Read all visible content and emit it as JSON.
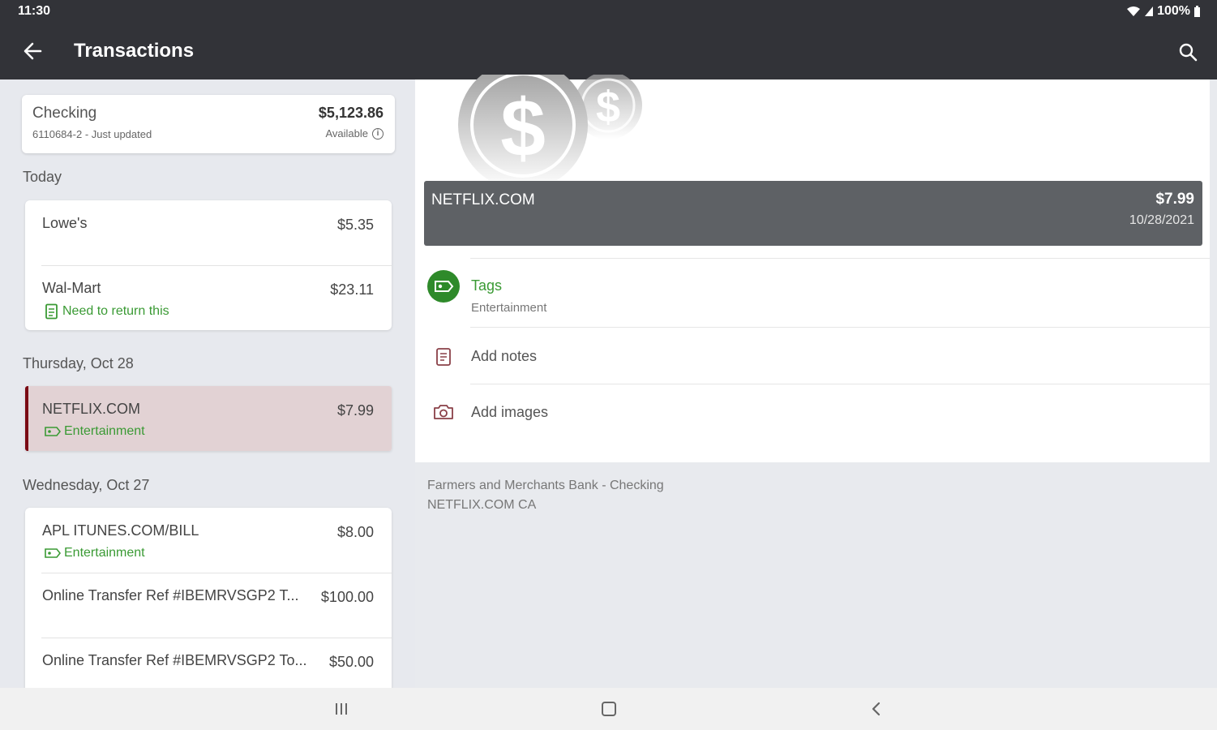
{
  "status": {
    "time": "11:30",
    "battery": "100%"
  },
  "appbar": {
    "title": "Transactions"
  },
  "account": {
    "name": "Checking",
    "subtitle": "6110684-2 - Just updated",
    "balance": "$5,123.86",
    "available_label": "Available"
  },
  "sections": [
    {
      "label": "Today",
      "rows": [
        {
          "name": "Lowe's",
          "amount": "$5.35"
        },
        {
          "name": "Wal-Mart",
          "amount": "$23.11",
          "note": "Need to return this"
        }
      ]
    },
    {
      "label": "Thursday, Oct 28",
      "rows": [
        {
          "name": "NETFLIX.COM",
          "amount": "$7.99",
          "tag": "Entertainment"
        }
      ]
    },
    {
      "label": "Wednesday, Oct 27",
      "rows": [
        {
          "name": "APL ITUNES.COM/BILL",
          "amount": "$8.00",
          "tag": "Entertainment"
        },
        {
          "name": "Online Transfer Ref #IBEMRVSGP2 T...",
          "amount": "$100.00"
        },
        {
          "name": "Online Transfer Ref #IBEMRVSGP2 To...",
          "amount": "$50.00"
        }
      ]
    }
  ],
  "detail": {
    "merchant": "NETFLIX.COM",
    "amount": "$7.99",
    "date": "10/28/2021",
    "tags_label": "Tags",
    "tags_value": "Entertainment",
    "notes_label": "Add notes",
    "images_label": "Add images",
    "bank": "Farmers and Merchants Bank - Checking",
    "description": "NETFLIX.COM CA"
  },
  "colors": {
    "bar": "#323338",
    "accent_green": "#2e8a2a",
    "selected_bg": "#e2d2d4",
    "selected_edge": "#7a0a14"
  },
  "icons": [
    "back-arrow-icon",
    "search-icon",
    "info-icon",
    "note-icon",
    "tag-icon",
    "camera-icon",
    "recents-icon",
    "home-icon",
    "nav-back-icon"
  ]
}
